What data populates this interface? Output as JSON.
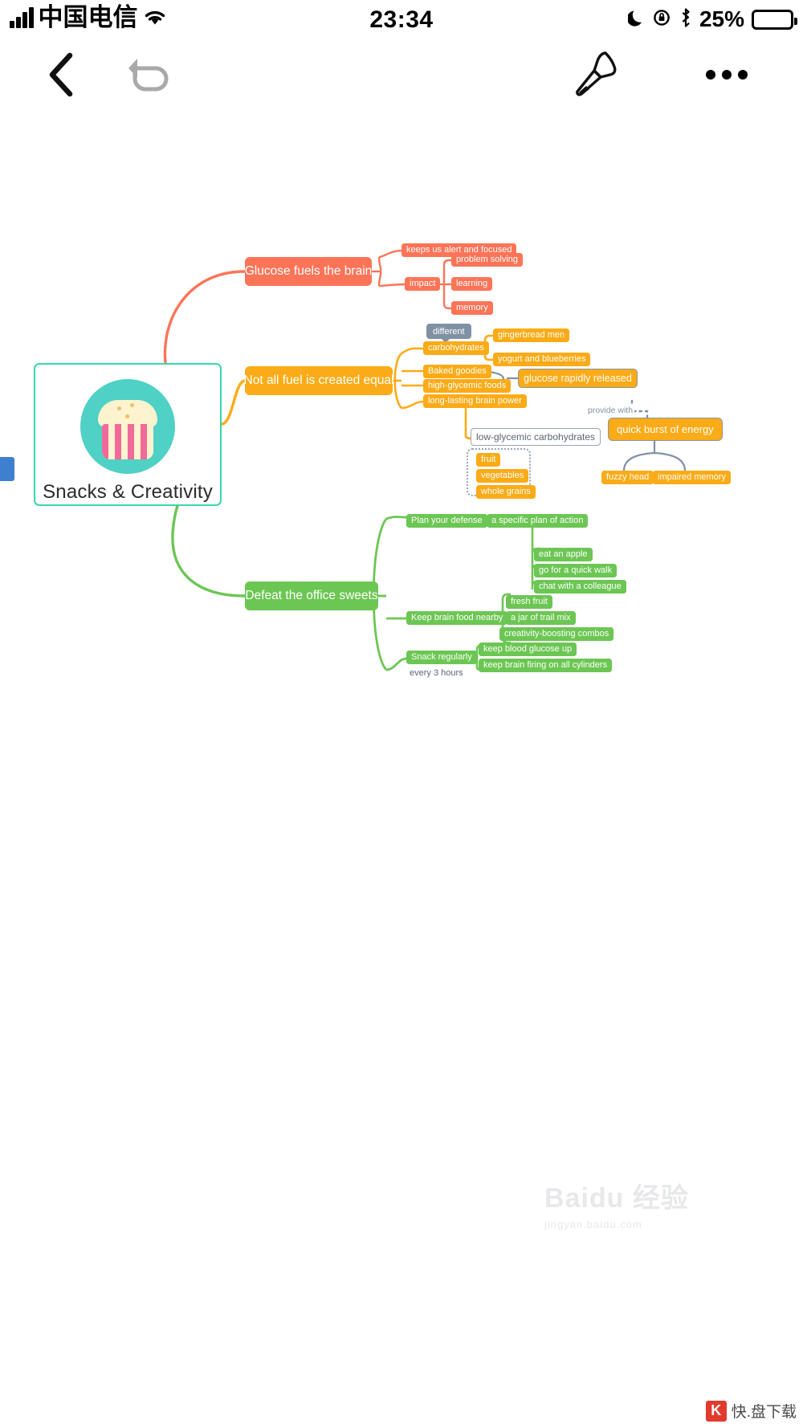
{
  "status_bar": {
    "carrier": "中国电信",
    "time": "23:34",
    "battery_percent": "25%",
    "icons": [
      "signal-bars-icon",
      "wifi-icon",
      "moon-icon",
      "rotation-lock-icon",
      "bluetooth-icon",
      "battery-icon"
    ]
  },
  "toolbar": {
    "back_label": "",
    "undo_label": "",
    "pen_label": "",
    "more_label": "",
    "icons": [
      "back-chevron-icon",
      "undo-arrow-icon",
      "marker-pen-icon",
      "more-options-icon"
    ]
  },
  "mindmap": {
    "root": {
      "title": "Snacks & Creativity",
      "image": "cupcake-icon",
      "border_color": "#38d9a9"
    },
    "branches": [
      {
        "id": "glucose",
        "label": "Glucose fuels the brain",
        "color": "#fc7458",
        "children": [
          {
            "label": "keeps us alert and focused"
          },
          {
            "label": "impact",
            "children": [
              {
                "label": "problem solving"
              },
              {
                "label": "learning"
              },
              {
                "label": "memory"
              }
            ]
          }
        ]
      },
      {
        "id": "notfuel",
        "label": "Not all fuel is created equal",
        "color": "#fbab17",
        "callout": "different",
        "children": [
          {
            "label": "carbohydrates",
            "children": [
              {
                "label": "gingerbread men"
              },
              {
                "label": "yogurt and blueberries"
              }
            ]
          },
          {
            "label": "Baked goodies"
          },
          {
            "label": "high-glycemic foods"
          },
          {
            "label": "long-lasting brain power"
          }
        ],
        "related": {
          "glucose_released": "glucose rapidly released",
          "edge_label": "provide with",
          "quick_burst": "quick burst of energy",
          "effects": [
            "fuzzy head",
            "impaired memory"
          ],
          "low_glycemic": "low-glycemic carbohydrates",
          "low_glycemic_items": [
            "fruit",
            "vegetables",
            "whole grains"
          ]
        }
      },
      {
        "id": "defeat",
        "label": "Defeat the office sweets",
        "color": "#6cc653",
        "children": [
          {
            "label": "Plan your defense",
            "children": [
              {
                "label": "a specific plan of action",
                "children": [
                  {
                    "label": "eat an apple"
                  },
                  {
                    "label": "go for a quick walk"
                  },
                  {
                    "label": "chat with a colleague"
                  }
                ]
              }
            ]
          },
          {
            "label": "Keep brain food nearby",
            "children": [
              {
                "label": "fresh fruit"
              },
              {
                "label": "a jar of trail mix"
              },
              {
                "label": "creativity-boosting combos"
              }
            ]
          },
          {
            "label": "Snack regularly",
            "note": "every 3 hours",
            "children": [
              {
                "label": "keep blood glucose up"
              },
              {
                "label": "keep brain firing on all cylinders"
              }
            ]
          }
        ]
      }
    ]
  },
  "watermark": {
    "baidu_main": "Baidu 经验",
    "baidu_sub": "jingyan.baidu.com",
    "kuaipan_logo": "K",
    "kuaipan_text": "快.盘下载"
  }
}
